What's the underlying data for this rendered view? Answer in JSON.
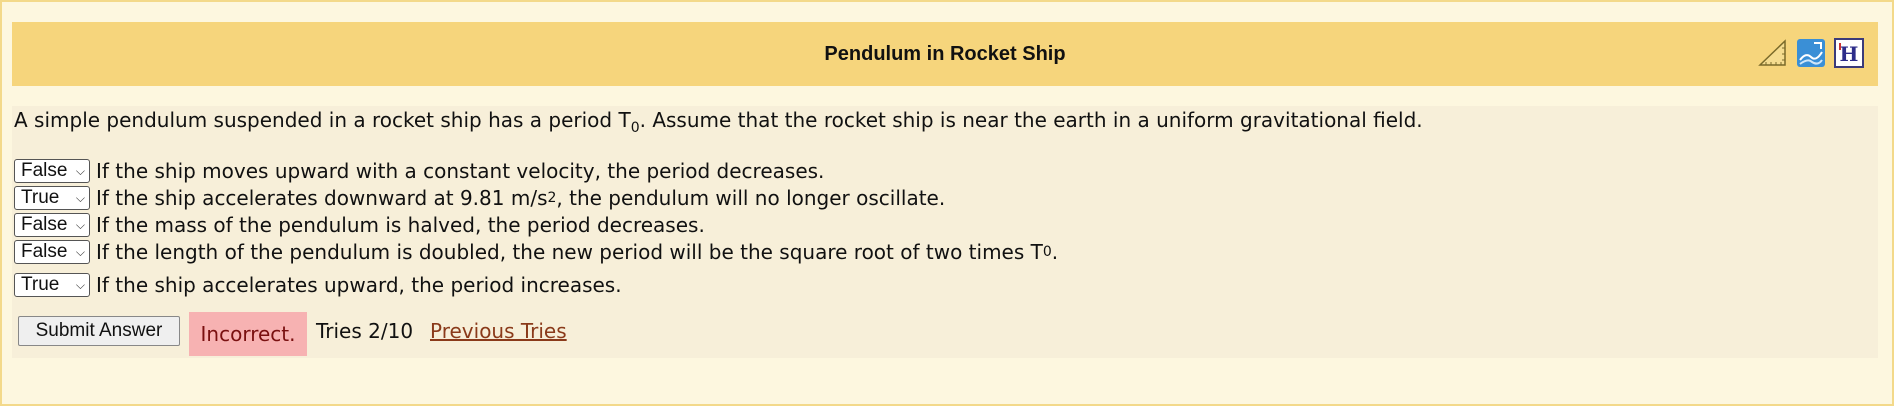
{
  "problem": {
    "title": "Pendulum in Rocket Ship",
    "intro_before": "A simple pendulum suspended in a rocket ship has a period T",
    "intro_sub": "0",
    "intro_after": ". Assume that the rocket ship is near the earth in a uniform gravitational field."
  },
  "header_icons": [
    "pencil-ruler-icon",
    "feedback-icon",
    "hint-icon"
  ],
  "statements": [
    {
      "selected": "False",
      "text": "If the ship moves upward with a constant velocity, the period decreases."
    },
    {
      "selected": "True",
      "text_before": "If the ship accelerates downward at 9.81 m/s",
      "text_sup": "2",
      "text_after": ", the pendulum will no longer oscillate."
    },
    {
      "selected": "False",
      "text": "If the mass of the pendulum is halved, the period decreases."
    },
    {
      "selected": "False",
      "text_before": "If the length of the pendulum is doubled, the new period will be the square root of two times T",
      "text_sub": "0",
      "text_after": "."
    },
    {
      "selected": "True",
      "text": "If the ship accelerates upward, the period increases."
    }
  ],
  "submit": {
    "label": "Submit Answer",
    "status": "Incorrect.",
    "tries": "Tries 2/10",
    "previous_tries": "Previous Tries"
  },
  "colors": {
    "header_bg": "#f6d57c",
    "content_bg": "#f7efd9",
    "incorrect_bg": "#f7b2b2",
    "link": "#8a3a1a"
  }
}
